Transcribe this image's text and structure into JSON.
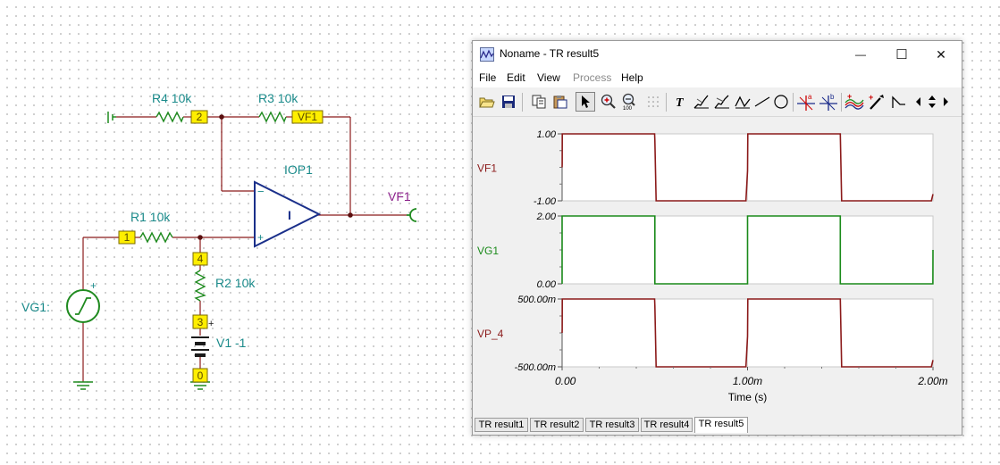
{
  "schematic": {
    "components": {
      "r4": "R4 10k",
      "r3": "R3 10k",
      "r1": "R1 10k",
      "r2": "R2 10k",
      "opamp": "IOP1",
      "vg1": "VG1:",
      "v1": "V1 -1",
      "output": "VF1"
    },
    "nodes": {
      "n2": "2",
      "vf1": "VF1",
      "n1": "1",
      "n4": "4",
      "n3": "3",
      "n0": "0"
    },
    "symbols": {
      "plus": "+",
      "minus": "−",
      "opamp_mark": "I"
    },
    "colors": {
      "wire": "#8b1a1a",
      "ground": "#1f8a1f",
      "opamp": "#1a2f8a",
      "label": "#1a8a8a",
      "output_label": "#8a1f8a"
    }
  },
  "window": {
    "title": "Noname - TR result5",
    "controls": {
      "minimize": "—",
      "maximize": "☐",
      "close": "✕"
    },
    "menu": [
      {
        "label": "File",
        "enabled": true
      },
      {
        "label": "Edit",
        "enabled": true
      },
      {
        "label": "View",
        "enabled": true
      },
      {
        "label": "Process",
        "enabled": false
      },
      {
        "label": "Help",
        "enabled": true
      }
    ],
    "toolbar": {
      "icons": [
        "open-folder-icon",
        "save-icon",
        "copy-icon",
        "paste-icon",
        "pointer-icon",
        "zoom-in-icon",
        "zoom-100-icon",
        "grid-icon",
        "text-icon",
        "curve-tool-icon",
        "curve-tool-2-icon",
        "curve-tool-3-icon",
        "line-icon",
        "circle-icon",
        "cursor-a-icon",
        "cursor-b-icon",
        "add-trace-icon",
        "probe-icon",
        "step-icon",
        "scroll-left-icon",
        "scroll-updown-icon",
        "scroll-right-icon"
      ],
      "zoom_label": "100"
    },
    "tabs": [
      {
        "label": "TR result1",
        "active": false
      },
      {
        "label": "TR result2",
        "active": false
      },
      {
        "label": "TR result3",
        "active": false
      },
      {
        "label": "TR result4",
        "active": false
      },
      {
        "label": "TR result5",
        "active": true
      }
    ]
  },
  "chart_data": {
    "type": "line",
    "xlabel": "Time (s)",
    "xlim": [
      0,
      0.002
    ],
    "x_ticks": [
      "0.00",
      "1.00m",
      "2.00m"
    ],
    "panels": [
      {
        "name": "VF1",
        "color": "#8b1a1a",
        "ylim": [
          -1,
          1
        ],
        "y_ticks": [
          "1.00",
          "-1.00"
        ],
        "x": [
          0,
          6e-07,
          1e-06,
          0.000499,
          0.0005,
          0.000507,
          0.0009915,
          0.001,
          0.0010015,
          0.0015,
          0.0015075,
          0.0019915,
          0.002
        ],
        "y": [
          0,
          0.1,
          1,
          1,
          0.8,
          -1,
          -1,
          -0.1,
          1,
          1,
          -1,
          -1,
          -0.8
        ]
      },
      {
        "name": "VG1",
        "color": "#1a8a1a",
        "ylim": [
          0,
          2
        ],
        "y_ticks": [
          "2.00",
          "0.00"
        ],
        "x": [
          0,
          1e-07,
          2e-07,
          0.0005,
          0.0005001,
          0.001,
          0.0010001,
          0.0015,
          0.0015001,
          0.0019995,
          0.002
        ],
        "y": [
          0,
          0.7,
          2,
          2,
          0,
          0,
          2,
          2,
          0,
          0,
          1
        ]
      },
      {
        "name": "VP_4",
        "color": "#8b1a1a",
        "ylim": [
          -0.5,
          0.5
        ],
        "y_ticks": [
          "500.00m",
          "-500.00m"
        ],
        "x": [
          0,
          6e-07,
          1e-06,
          0.000499,
          0.0005,
          0.000507,
          0.0009915,
          0.001,
          0.0010015,
          0.0015,
          0.0015075,
          0.0019915,
          0.002
        ],
        "y": [
          0,
          0.05,
          0.5,
          0.5,
          0.4,
          -0.5,
          -0.5,
          -0.05,
          0.5,
          0.5,
          -0.5,
          -0.5,
          -0.4
        ]
      }
    ]
  }
}
